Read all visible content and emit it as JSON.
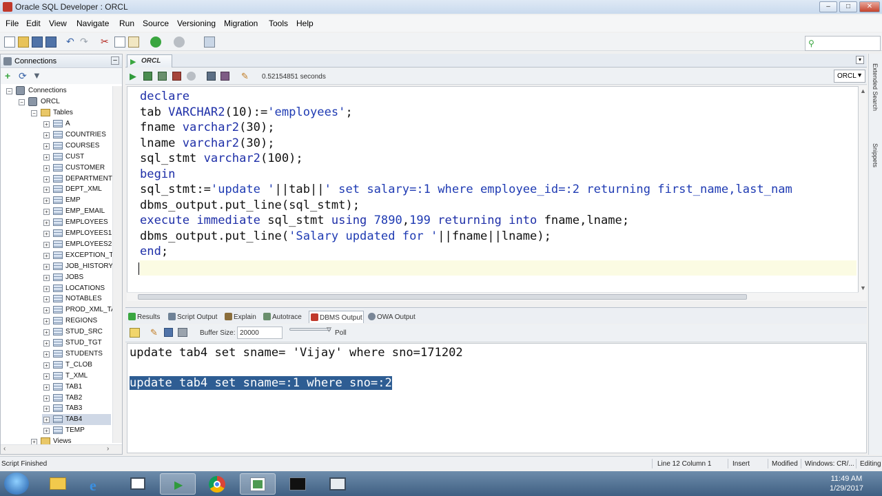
{
  "window": {
    "title": "Oracle SQL Developer : ORCL",
    "controls": [
      "minimize",
      "maximize",
      "close"
    ]
  },
  "menu": [
    "File",
    "Edit",
    "View",
    "Navigate",
    "Run",
    "Source",
    "Versioning",
    "Migration",
    "Tools",
    "Help"
  ],
  "connections_panel": {
    "header": "Connections",
    "root": "Connections",
    "connection": "ORCL",
    "tables_folder": "Tables",
    "tables": [
      "A",
      "COUNTRIES",
      "COURSES",
      "CUST",
      "CUSTOMER",
      "DEPARTMENTS",
      "DEPT_XML",
      "EMP",
      "EMP_EMAIL",
      "EMPLOYEES",
      "EMPLOYEES1",
      "EMPLOYEES2",
      "EXCEPTION_TE",
      "JOB_HISTORY",
      "JOBS",
      "LOCATIONS",
      "NOTABLES",
      "PROD_XML_TA",
      "REGIONS",
      "STUD_SRC",
      "STUD_TGT",
      "STUDENTS",
      "T_CLOB",
      "T_XML",
      "TAB1",
      "TAB2",
      "TAB3",
      "TAB4",
      "TEMP"
    ],
    "selected_table": "TAB4",
    "views_folder": "Views"
  },
  "editor": {
    "tab_label": "ORCL",
    "elapsed": "0.52154851 seconds",
    "connection": "ORCL",
    "code_lines": [
      [
        {
          "t": "declare",
          "c": "kw"
        }
      ],
      [
        {
          "t": "tab ",
          "c": ""
        },
        {
          "t": "VARCHAR2",
          "c": "ty"
        },
        {
          "t": "(10):=",
          "c": ""
        },
        {
          "t": "'employees'",
          "c": "str"
        },
        {
          "t": ";",
          "c": ""
        }
      ],
      [
        {
          "t": "fname ",
          "c": ""
        },
        {
          "t": "varchar2",
          "c": "ty"
        },
        {
          "t": "(30);",
          "c": ""
        }
      ],
      [
        {
          "t": "lname ",
          "c": ""
        },
        {
          "t": "varchar2",
          "c": "ty"
        },
        {
          "t": "(30);",
          "c": ""
        }
      ],
      [
        {
          "t": "sql_stmt ",
          "c": ""
        },
        {
          "t": "varchar2",
          "c": "ty"
        },
        {
          "t": "(100);",
          "c": ""
        }
      ],
      [
        {
          "t": "begin",
          "c": "kw"
        }
      ],
      [
        {
          "t": "sql_stmt:=",
          "c": ""
        },
        {
          "t": "'update '",
          "c": "str"
        },
        {
          "t": "||tab||",
          "c": ""
        },
        {
          "t": "' set salary=:1 where employee_id=:2 returning first_name,last_nam",
          "c": "str"
        }
      ],
      [
        {
          "t": "dbms_output.put_line(sql_stmt);",
          "c": ""
        }
      ],
      [
        {
          "t": "execute immediate ",
          "c": "kw"
        },
        {
          "t": "sql_stmt ",
          "c": ""
        },
        {
          "t": "using ",
          "c": "kw"
        },
        {
          "t": "7890",
          "c": "str"
        },
        {
          "t": ",",
          "c": ""
        },
        {
          "t": "199 ",
          "c": "str"
        },
        {
          "t": "returning into ",
          "c": "kw"
        },
        {
          "t": "fname,lname;",
          "c": ""
        }
      ],
      [
        {
          "t": "dbms_output.put_line(",
          "c": ""
        },
        {
          "t": "'Salary updated for '",
          "c": "str"
        },
        {
          "t": "||fname||lname);",
          "c": ""
        }
      ],
      [
        {
          "t": "end",
          "c": "kw"
        },
        {
          "t": ";",
          "c": ""
        }
      ]
    ]
  },
  "output_tabs": [
    "Results",
    "Script Output",
    "Explain",
    "Autotrace",
    "DBMS Output",
    "OWA Output"
  ],
  "active_output_tab": "DBMS Output",
  "output_toolbar": {
    "buffer_label": "Buffer Size:",
    "buffer_value": "20000",
    "poll_label": "Poll"
  },
  "output_lines": [
    "update tab4 set sname= 'Vijay' where sno=171202",
    "update tab4 set sname=:1 where sno=:2"
  ],
  "right_strip": [
    "Extended Search",
    "Snippets"
  ],
  "status": {
    "message": "Script Finished",
    "position": "Line 12 Column 1",
    "mode": "Insert",
    "modified": "Modified",
    "line_ending": "Windows: CR/...",
    "editing": "Editing"
  },
  "taskbar": {
    "time": "11:49 AM",
    "date": "1/29/2017",
    "apps": [
      "start",
      "explorer",
      "internet-explorer",
      "app",
      "media",
      "chrome",
      "sqldeveloper",
      "terminal",
      "app2"
    ]
  },
  "colors": {
    "keyword": "#1e2fa8",
    "selection": "#2e5d93",
    "current_line": "#fbfbe3"
  }
}
